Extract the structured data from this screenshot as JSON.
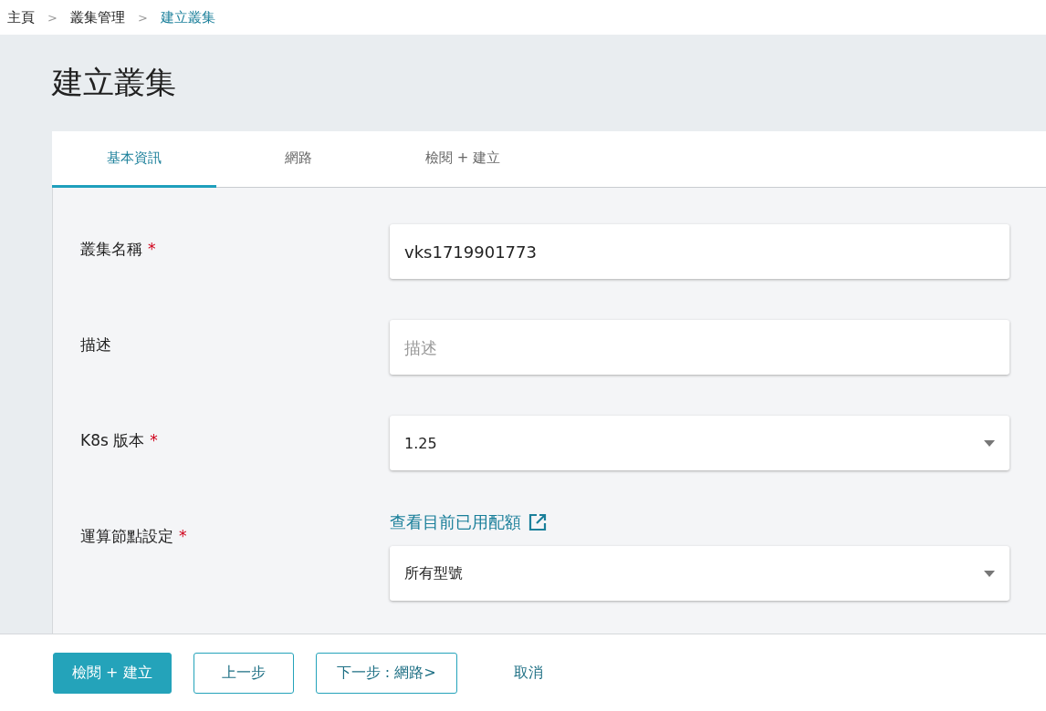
{
  "breadcrumb": [
    {
      "label": "主頁",
      "current": false
    },
    {
      "label": "叢集管理",
      "current": false
    },
    {
      "label": "建立叢集",
      "current": true
    }
  ],
  "breadcrumb_separator": ">",
  "page_title": "建立叢集",
  "tabs": [
    {
      "label": "基本資訊",
      "selected": true
    },
    {
      "label": "網路",
      "selected": false
    },
    {
      "label": "檢閱 + 建立",
      "selected": false
    }
  ],
  "form": [
    {
      "label": "叢集名稱",
      "required_mark": "*",
      "kind": "text",
      "value": "vks1719901773"
    },
    {
      "label": "描述",
      "kind": "text",
      "placeholder": "描述"
    },
    {
      "label": "K8s 版本",
      "required_mark": "*",
      "kind": "select",
      "value": "1.25"
    },
    {
      "label": "運算節點設定",
      "required_mark": "*",
      "kind": "select",
      "link": "查看目前已用配額",
      "value": "所有型號"
    }
  ],
  "buttons": [
    {
      "label": "檢閱 + 建立",
      "kind": "primary"
    },
    {
      "label": "上一步",
      "kind": "outline"
    },
    {
      "label": "下一步 : 網路>",
      "kind": "outline"
    },
    {
      "label": "取消",
      "kind": "text"
    }
  ]
}
